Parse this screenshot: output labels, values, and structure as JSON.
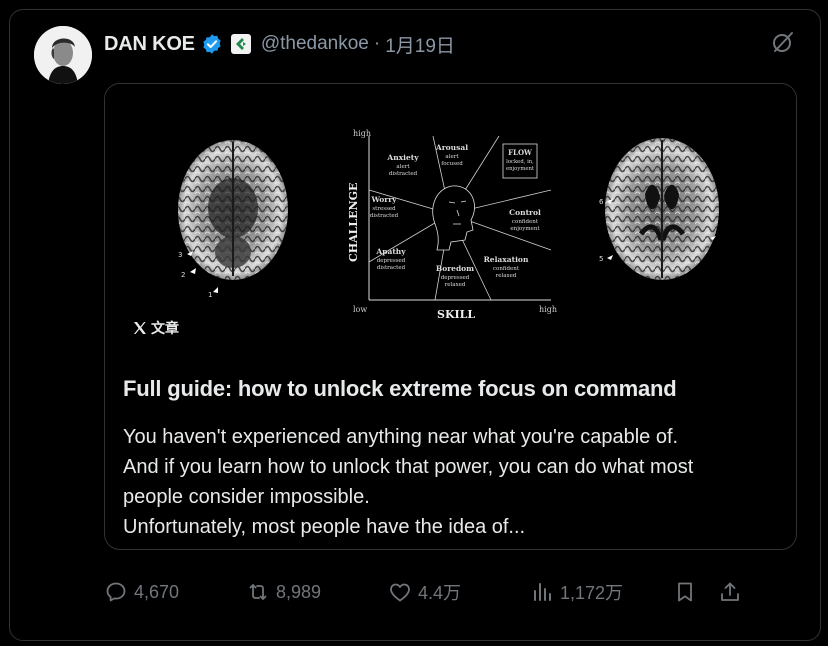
{
  "author": {
    "name": "DAN KOE",
    "handle": "@thedankoe",
    "separator": "·",
    "date": "1月19日"
  },
  "card": {
    "badge": "文章",
    "title": "Full guide: how to unlock extreme focus on command",
    "description": [
      "You haven't experienced anything near what you're capable of.",
      "And if you learn how to unlock that power, you can do what most",
      "people consider impossible.",
      "Unfortunately, most people have the idea of..."
    ],
    "diagram": {
      "y_axis": "CHALLENGE",
      "x_axis": "SKILL",
      "y_high": "high",
      "x_low": "low",
      "x_high": "high",
      "regions": [
        {
          "name": "Arousal",
          "sub1": "alert",
          "sub2": "focused"
        },
        {
          "name": "FLOW",
          "sub1": "locked, in,",
          "sub2": "enjoyment"
        },
        {
          "name": "Anxiety",
          "sub1": "alert",
          "sub2": "distracted"
        },
        {
          "name": "Worry",
          "sub1": "stressed",
          "sub2": "distracted"
        },
        {
          "name": "Control",
          "sub1": "confident",
          "sub2": "enjoyment"
        },
        {
          "name": "Apathy",
          "sub1": "depressed",
          "sub2": "distracted"
        },
        {
          "name": "Boredom",
          "sub1": "depressed",
          "sub2": "relaxed"
        },
        {
          "name": "Relaxation",
          "sub1": "confident",
          "sub2": "relaxed"
        }
      ],
      "brain_left_markers": [
        "3",
        "2",
        "1"
      ],
      "brain_right_markers": [
        "6",
        "5"
      ]
    }
  },
  "actions": {
    "replies": "4,670",
    "reposts": "8,989",
    "likes": "4.4万",
    "views": "1,172万"
  },
  "colors": {
    "verified": "#1d9bf0",
    "muted": "#71767b",
    "border": "#2f3336"
  }
}
